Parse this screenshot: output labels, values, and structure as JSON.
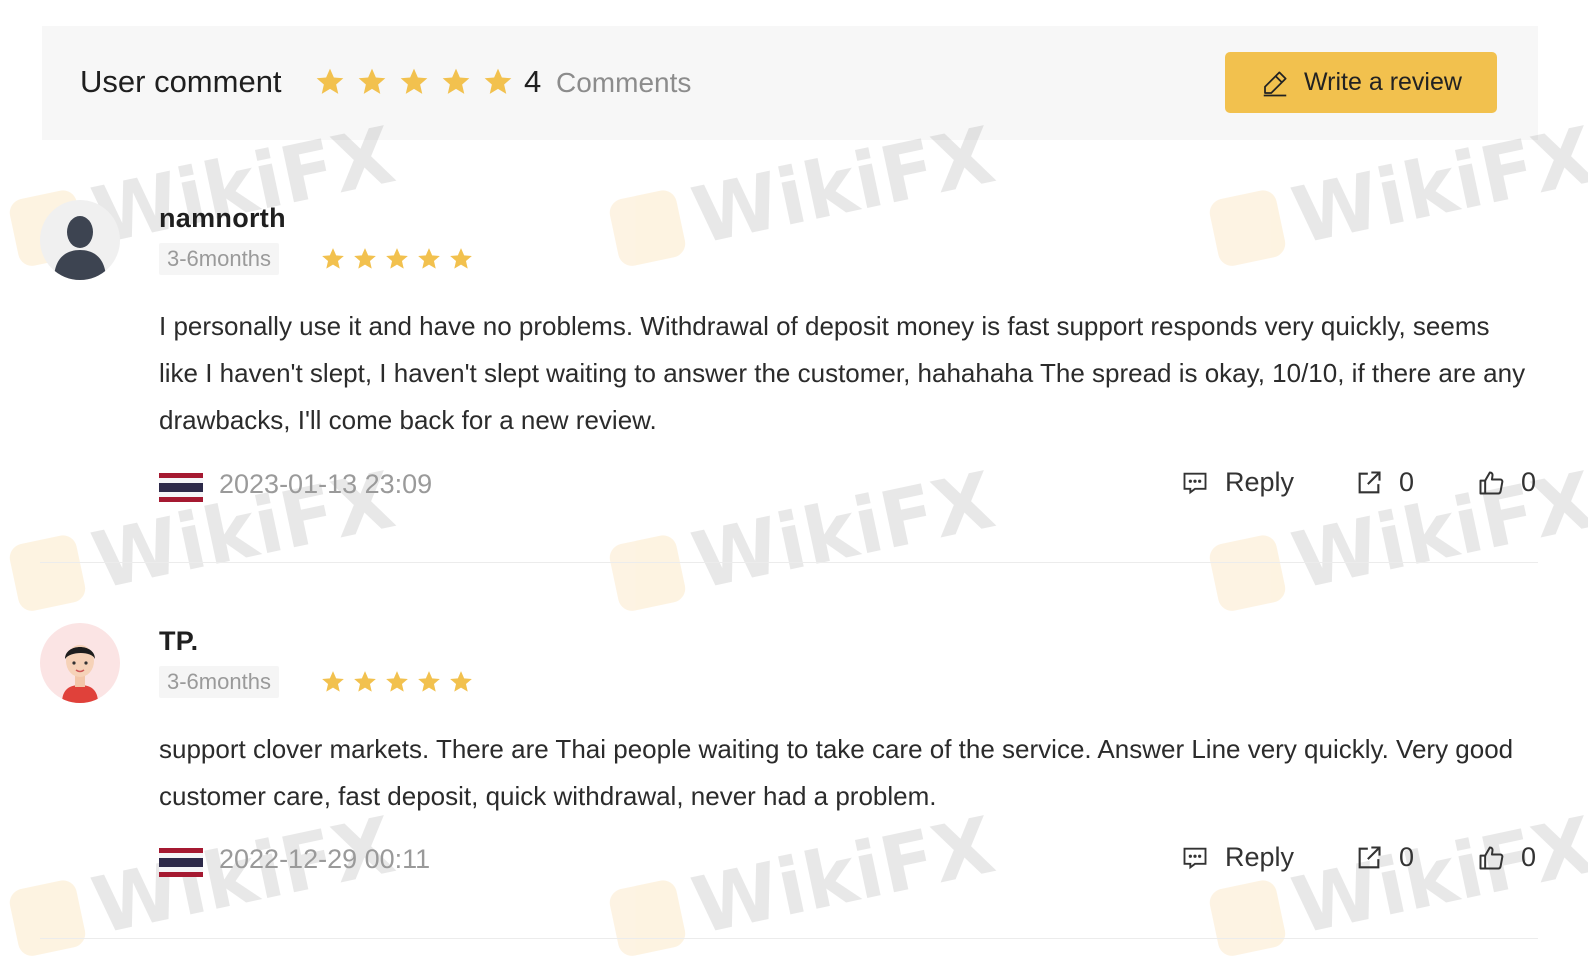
{
  "header": {
    "title": "User comment",
    "overall_rating": 5,
    "comment_count": "4",
    "comment_count_label": "Comments",
    "write_review_label": "Write a review"
  },
  "reviews": [
    {
      "username": "namnorth",
      "avatar": "silhouette-avatar",
      "tenure": "3-6months",
      "rating": 5,
      "body": "I personally use it and have no problems. Withdrawal of deposit money is fast support responds very quickly, seems like I haven't slept, I haven't slept waiting to answer the customer, hahahaha The spread is okay, 10/10, if there are any drawbacks, I'll come back for a new review.",
      "country_flag": "thailand-flag",
      "date": "2023-01-13 23:09",
      "reply_label": "Reply",
      "share_count": "0",
      "like_count": "0"
    },
    {
      "username": "TP.",
      "avatar": "cartoon-avatar",
      "tenure": "3-6months",
      "rating": 5,
      "body": "support clover markets. There are Thai people waiting to take care of the service. Answer Line very quickly. Very good customer care, fast deposit, quick withdrawal, never had a problem.",
      "country_flag": "thailand-flag",
      "date": "2022-12-29 00:11",
      "reply_label": "Reply",
      "share_count": "0",
      "like_count": "0"
    }
  ],
  "watermark_text": "WikiFX",
  "colors": {
    "star": "#f2c14e",
    "button": "#f2c14e",
    "header_bg": "#f7f7f7",
    "muted_text": "#9a9a9a"
  }
}
